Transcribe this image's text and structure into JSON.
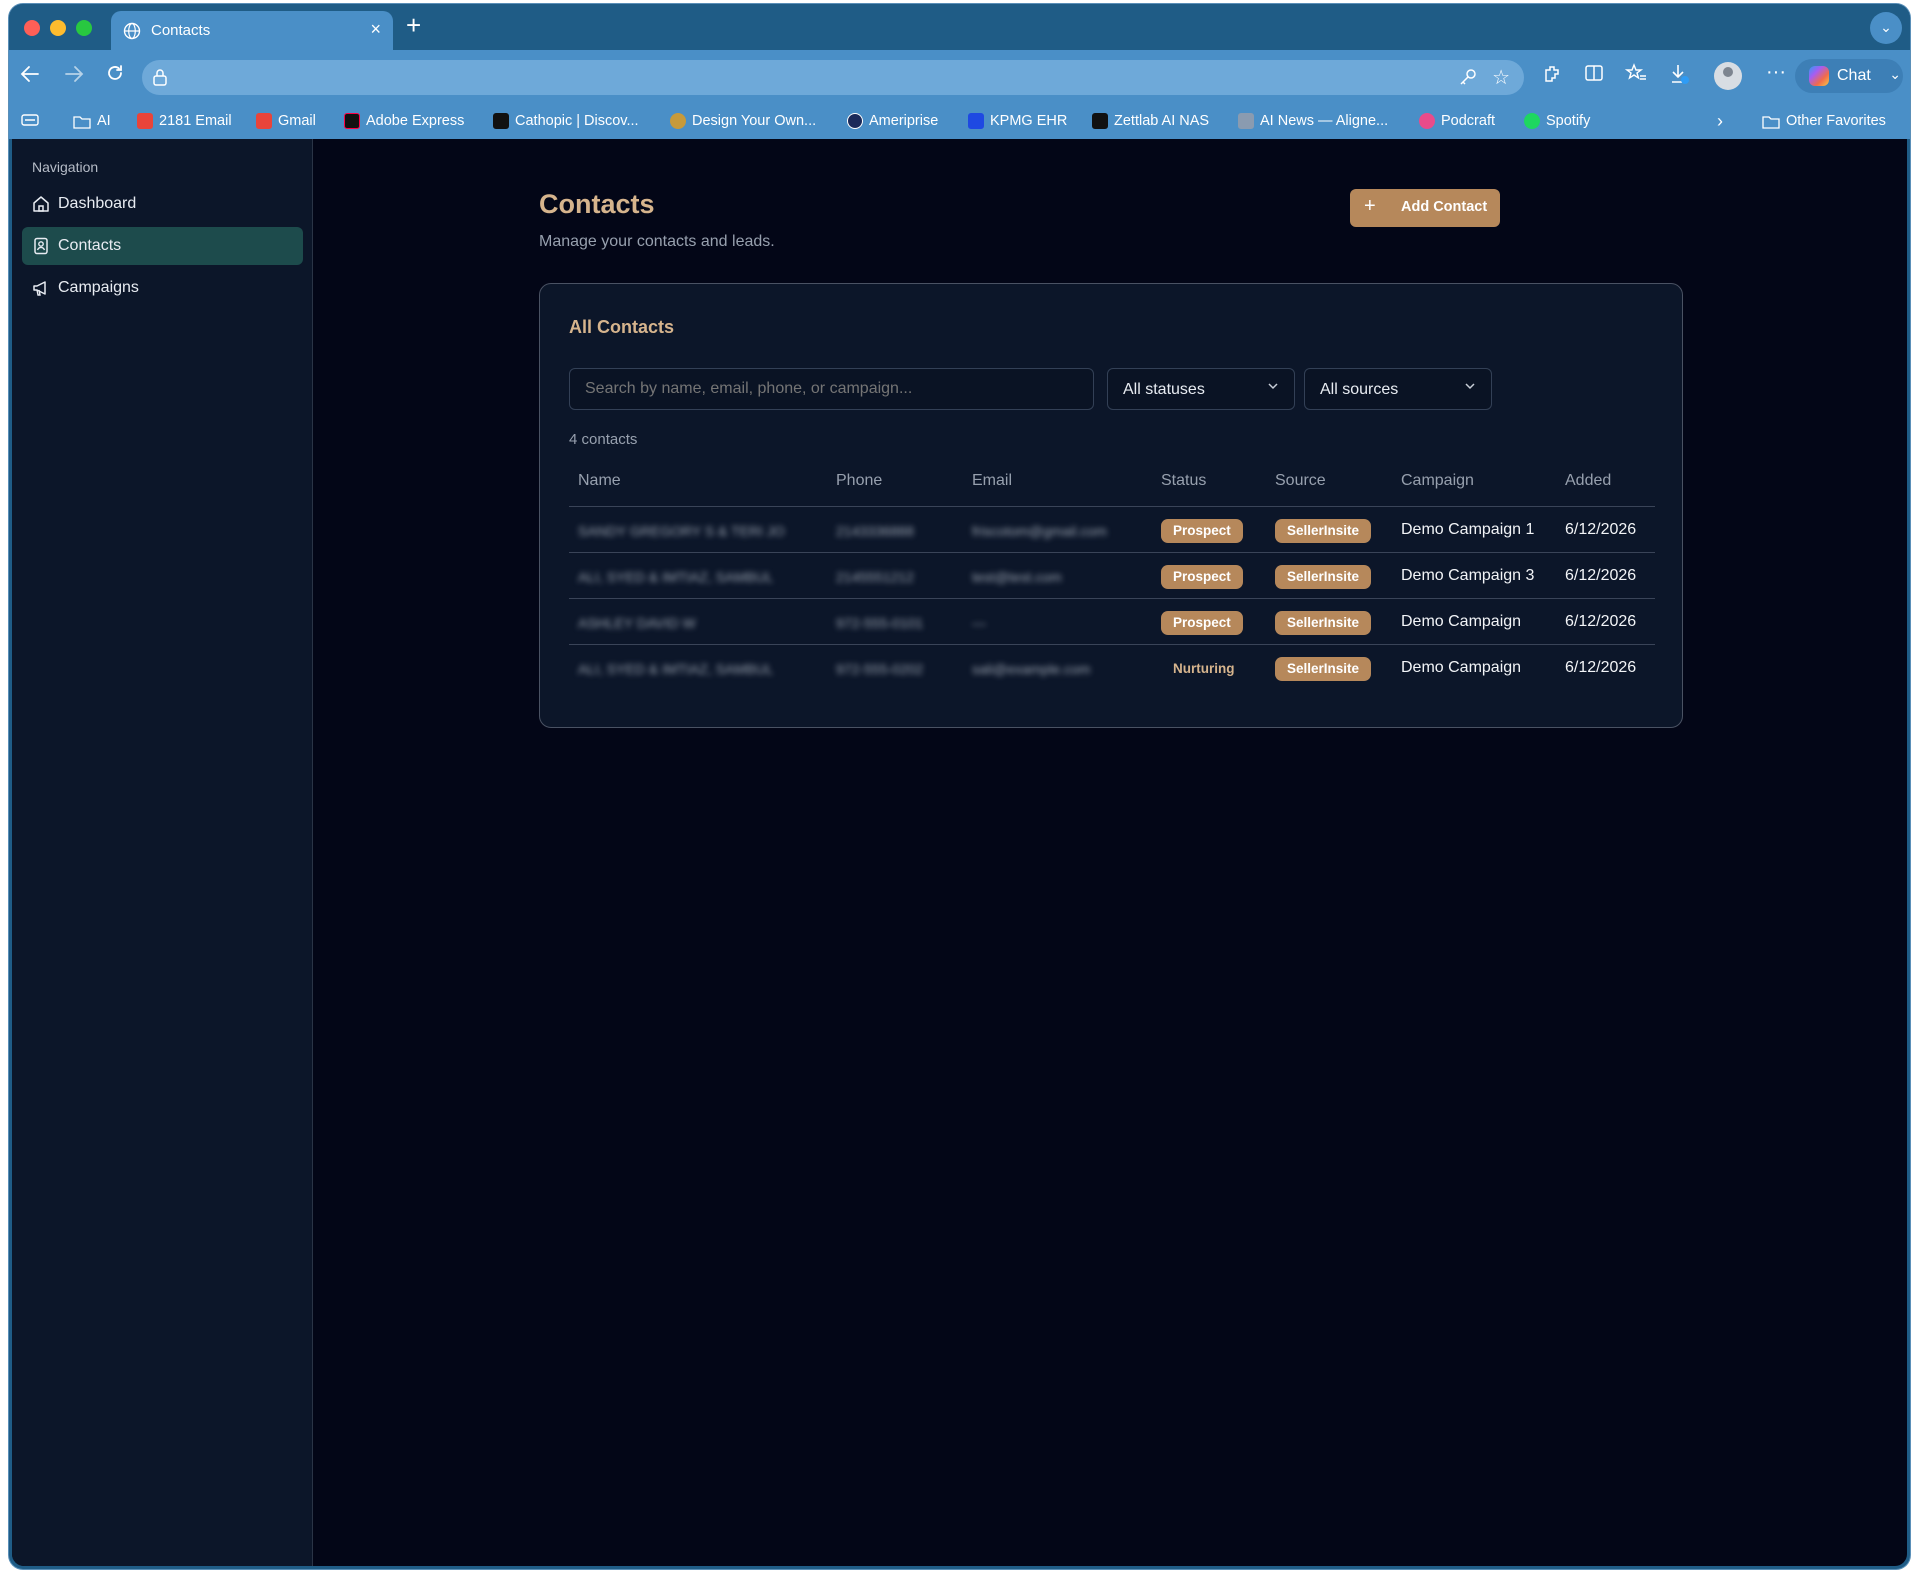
{
  "browser": {
    "tab_title": "Contacts",
    "tab_close": "×",
    "new_tab": "+",
    "tab_menu": "⌄",
    "chat_label": "Chat",
    "bookmarks": [
      {
        "label": "",
        "icon": "tab-icon"
      },
      {
        "label": "AI",
        "icon": "folder-icon"
      },
      {
        "label": "2181 Email",
        "icon": "gmail-icon"
      },
      {
        "label": "Gmail",
        "icon": "gmail-icon"
      },
      {
        "label": "Adobe Express",
        "icon": "adobe-icon"
      },
      {
        "label": "Cathopic | Discov...",
        "icon": "cathopic-icon"
      },
      {
        "label": "Design Your Own...",
        "icon": "design-icon"
      },
      {
        "label": "Ameriprise",
        "icon": "ameriprise-icon"
      },
      {
        "label": "KPMG EHR",
        "icon": "kpmg-icon"
      },
      {
        "label": "Zettlab AI NAS",
        "icon": "zettlab-icon"
      },
      {
        "label": "AI News — Aligne...",
        "icon": "satellite-icon"
      },
      {
        "label": "Podcraft",
        "icon": "podcraft-icon"
      },
      {
        "label": "Spotify",
        "icon": "spotify-icon"
      }
    ],
    "bookmarks_more": "›",
    "other_favorites": "Other Favorites"
  },
  "sidebar": {
    "heading": "Navigation",
    "items": [
      {
        "label": "Dashboard",
        "icon": "home-icon",
        "active": false
      },
      {
        "label": "Contacts",
        "icon": "contact-book-icon",
        "active": true
      },
      {
        "label": "Campaigns",
        "icon": "megaphone-icon",
        "active": false
      }
    ]
  },
  "page": {
    "title": "Contacts",
    "subtitle": "Manage your contacts and leads.",
    "add_button": "Add Contact",
    "add_icon": "+"
  },
  "card": {
    "title": "All Contacts",
    "search_placeholder": "Search by name, email, phone, or campaign...",
    "status_filter": "All statuses",
    "source_filter": "All sources",
    "count": "4 contacts",
    "columns": [
      "Name",
      "Phone",
      "Email",
      "Status",
      "Source",
      "Campaign",
      "Added"
    ],
    "rows": [
      {
        "name": "SANDY GREGORY S & TERI JO",
        "phone": "2143336888",
        "email": "friscotom@gmail.com",
        "status": "Prospect",
        "source": "SellerInsite",
        "campaign": "Demo Campaign 1",
        "added": "6/12/2026"
      },
      {
        "name": "ALI, SYED & IMTIAZ, SAMBUL",
        "phone": "2145551212",
        "email": "test@test.com",
        "status": "Prospect",
        "source": "SellerInsite",
        "campaign": "Demo Campaign 3",
        "added": "6/12/2026"
      },
      {
        "name": "ASHLEY DAVID W",
        "phone": "972-555-0101",
        "email": "—",
        "status": "Prospect",
        "source": "SellerInsite",
        "campaign": "Demo Campaign",
        "added": "6/12/2026"
      },
      {
        "name": "ALI, SYED & IMTIAZ, SAMBUL",
        "phone": "972-555-0202",
        "email": "sali@example.com",
        "status": "Nurturing",
        "source": "SellerInsite",
        "campaign": "Demo Campaign",
        "added": "6/12/2026"
      }
    ]
  },
  "colors": {
    "accent": "#b6885b",
    "title_gold": "#d6b48d",
    "background": "#030617",
    "sidebar": "#0c1629",
    "active_nav": "#1d4b4c"
  }
}
